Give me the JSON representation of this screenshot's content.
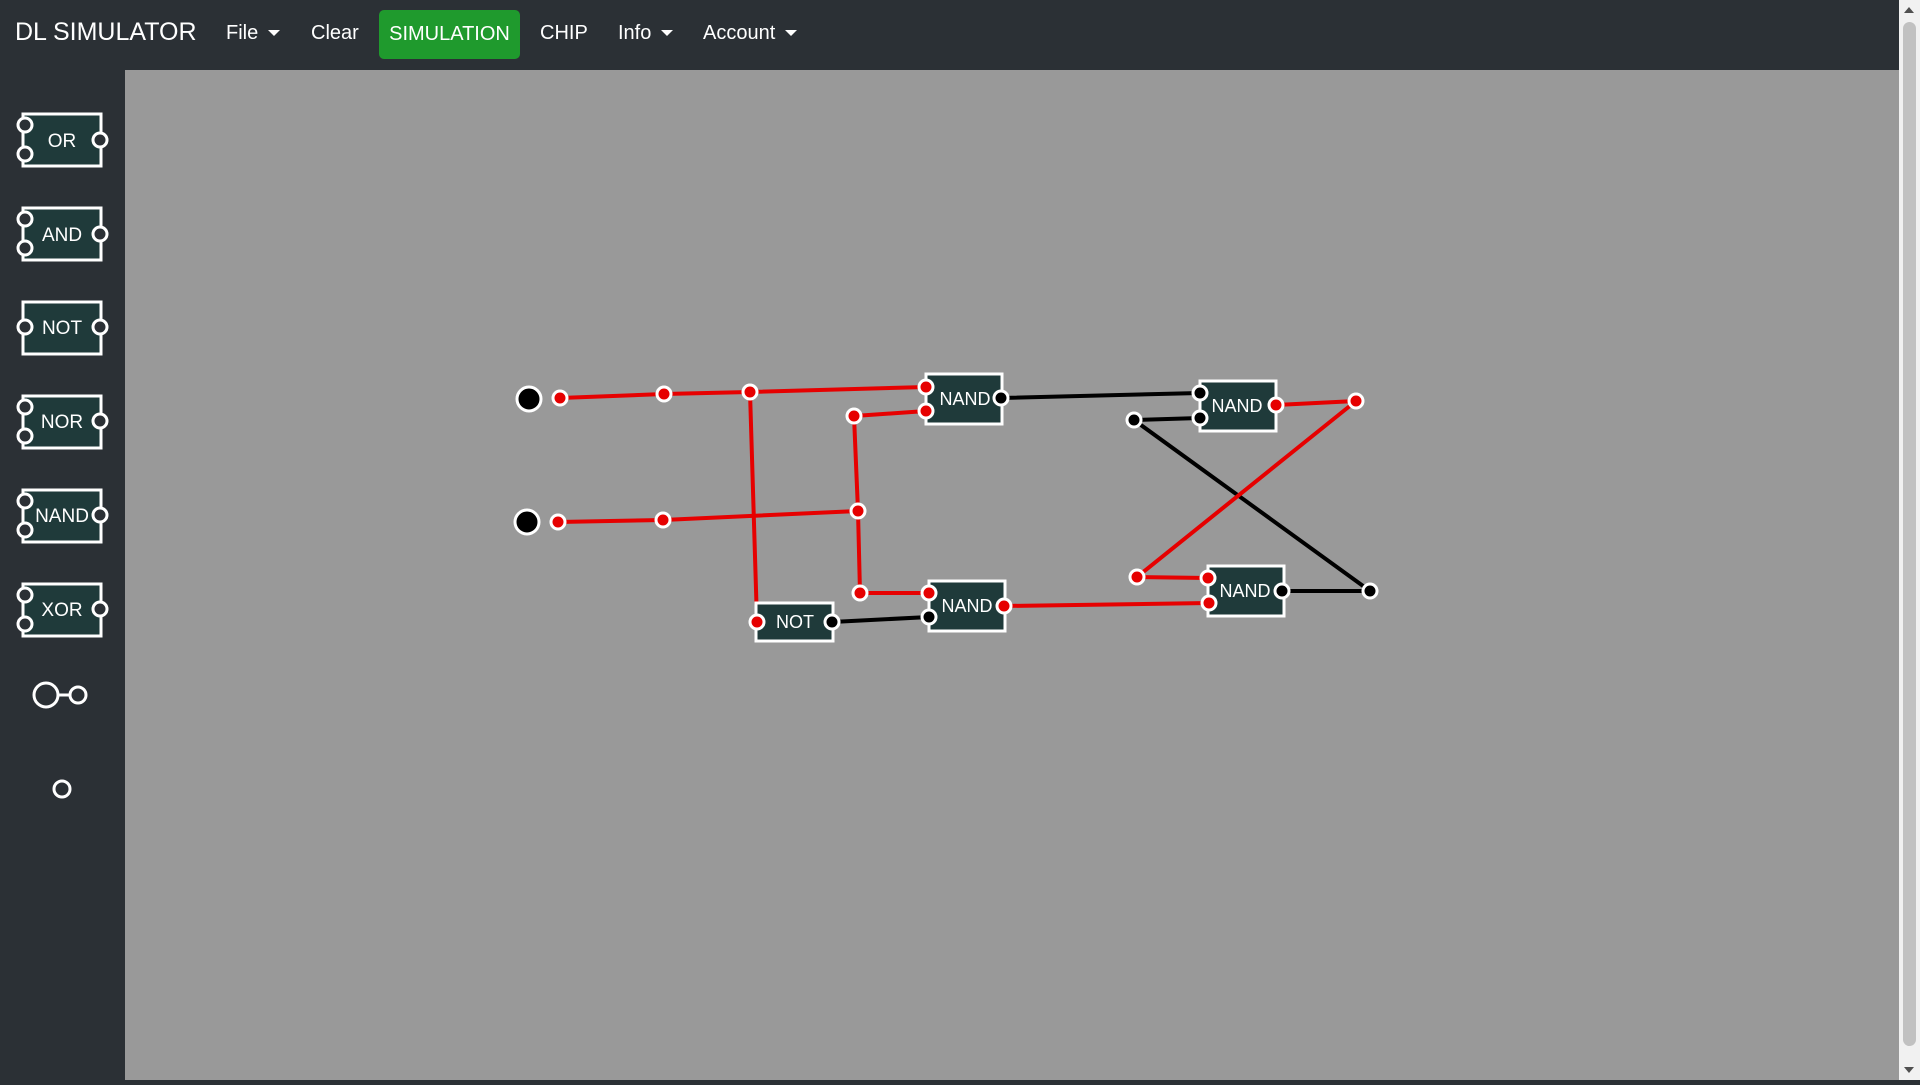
{
  "navbar": {
    "brand": "DL SIMULATOR",
    "file_label": "File",
    "clear_label": "Clear",
    "simulation_label": "SIMULATION",
    "chip_label": "CHIP",
    "info_label": "Info",
    "account_label": "Account"
  },
  "palette": {
    "or": "OR",
    "and": "AND",
    "not": "NOT",
    "nor": "NOR",
    "nand": "NAND",
    "xor": "XOR"
  },
  "circuit": {
    "gate_nand_top_left": "NAND",
    "gate_nand_bottom_left": "NAND",
    "gate_not": "NOT",
    "gate_nand_top_right": "NAND",
    "gate_nand_bottom_right": "NAND"
  },
  "colors": {
    "active_wire": "#e60000",
    "inactive_wire": "#000000",
    "gate_fill": "#1f3a3a",
    "simulation_button": "#1f9a2d",
    "canvas": "#999999"
  }
}
